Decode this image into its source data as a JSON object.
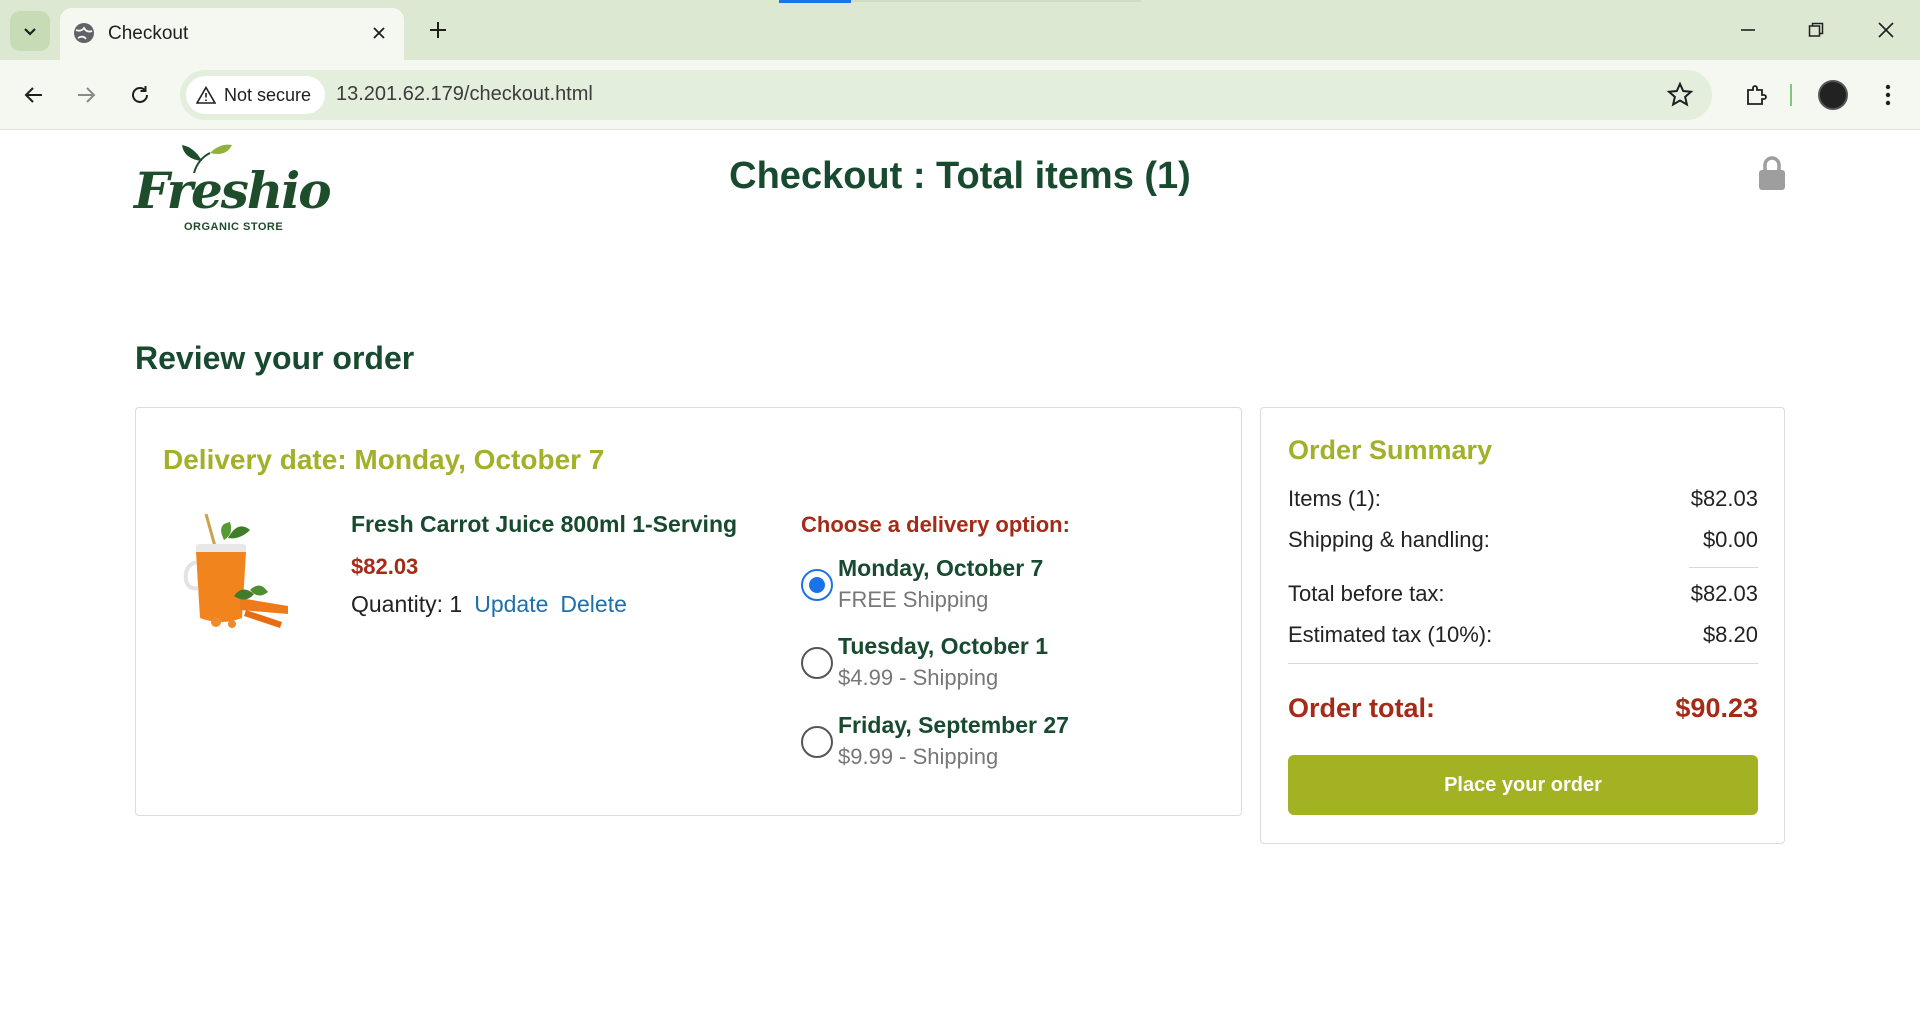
{
  "browser": {
    "tab_title": "Checkout",
    "security_label": "Not secure",
    "url": "13.201.62.179/checkout.html"
  },
  "header": {
    "logo_text": "Freshio",
    "logo_subtitle": "ORGANIC STORE",
    "title": "Checkout : Total items (1)"
  },
  "review": {
    "heading": "Review your order",
    "delivery_date": "Delivery date: Monday, October 7",
    "product": {
      "name": "Fresh Carrot Juice 800ml 1-Serving",
      "price": "$82.03",
      "quantity_label": "Quantity: 1",
      "update_label": "Update",
      "delete_label": "Delete"
    },
    "options_heading": "Choose a delivery option:",
    "options": [
      {
        "date": "Monday, October 7",
        "price": "FREE Shipping",
        "selected": true
      },
      {
        "date": "Tuesday, October 1",
        "price": "$4.99 - Shipping",
        "selected": false
      },
      {
        "date": "Friday, September 27",
        "price": "$9.99 - Shipping",
        "selected": false
      }
    ]
  },
  "summary": {
    "title": "Order Summary",
    "items_label": "Items (1):",
    "items_value": "$82.03",
    "shipping_label": "Shipping & handling:",
    "shipping_value": "$0.00",
    "before_tax_label": "Total before tax:",
    "before_tax_value": "$82.03",
    "tax_label": "Estimated tax (10%):",
    "tax_value": "$8.20",
    "total_label": "Order total:",
    "total_value": "$90.23",
    "place_order_label": "Place your order"
  },
  "colors": {
    "brand_green": "#174a2f",
    "accent_olive": "#a2b02a",
    "price_red": "#a42b18",
    "link_blue": "#1f6fa8",
    "radio_blue": "#1a73e8"
  }
}
